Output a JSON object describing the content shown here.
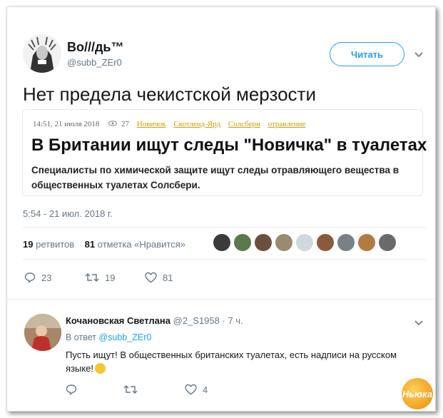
{
  "tweet": {
    "author_name": "Во///дь™",
    "author_handle": "@subb_ZEr0",
    "follow_label": "Читать",
    "text": "Нет предела чекистской мерзости",
    "card": {
      "datetime": "14:51, 21 июля 2018",
      "views": "27",
      "tags": [
        "Новичок",
        "Скотленд-Ярд",
        "Солсбери",
        "отравление"
      ],
      "title": "В Британии ищут следы \"Новичка\" в туалетах",
      "description": "Специалисты по химической защите ищут следы отравляющего вещества в общественных туалетах Солсбери."
    },
    "timestamp": "5:54 - 21 июл. 2018 г.",
    "retweets_count": "19",
    "retweets_label": "ретвитов",
    "likes_count": "81",
    "likes_label": "отметка «Нравится»",
    "actions": {
      "reply_count": "23",
      "retweet_count": "19",
      "like_count": "81"
    }
  },
  "reply": {
    "author_name": "Кочановская Светлана",
    "author_handle": "@2_S1958",
    "time": "· 7 ч.",
    "in_reply_prefix": "В ответ",
    "in_reply_handle": "@subb_ZEr0",
    "text": "Пусть ищут! В общественных британских туалетах, есть надписи на русском языке!",
    "actions": {
      "reply_count": "",
      "retweet_count": "",
      "like_count": "4"
    }
  },
  "watermark": "Ньюка",
  "colors": {
    "accent": "#1da1f2",
    "muted": "#657786",
    "tag": "#c8a000"
  },
  "icons": [
    "chevron-down-icon",
    "eye-icon",
    "reply-icon",
    "retweet-icon",
    "heart-icon"
  ]
}
